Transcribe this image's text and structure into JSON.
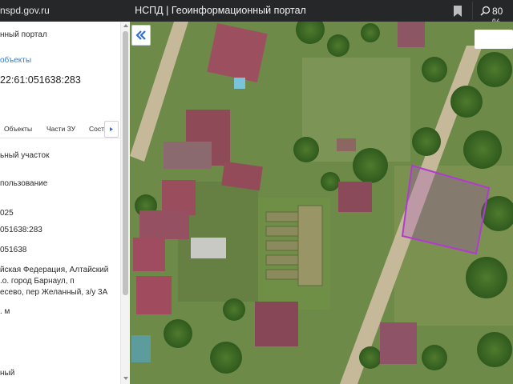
{
  "browser": {
    "url": "nspd.gov.ru",
    "title": "НСПД | Геоинформационный портал",
    "zoom": "80 %"
  },
  "panel": {
    "portal_fragment": "нный портал",
    "objects_link": "объекты",
    "cad_number": "22:61:051638:283",
    "tabs": [
      "Объекты",
      "Части ЗУ",
      "Сост"
    ],
    "lines": [
      "ьный участок",
      "пользование",
      "025",
      "051638:283",
      "051638",
      "йская Федерация, Алтайский",
      ".о. город Барнаул, п",
      "есево, пер Желанный, з/у 3А",
      ". м",
      "ный"
    ]
  },
  "map": {
    "collapse_label": "«",
    "parcel_color": "#b23ad0",
    "road_color": "#c6b99a"
  },
  "colors": {
    "topbar_bg": "#262729",
    "link": "#2d7fd3",
    "accent": "#2d6fd8"
  }
}
